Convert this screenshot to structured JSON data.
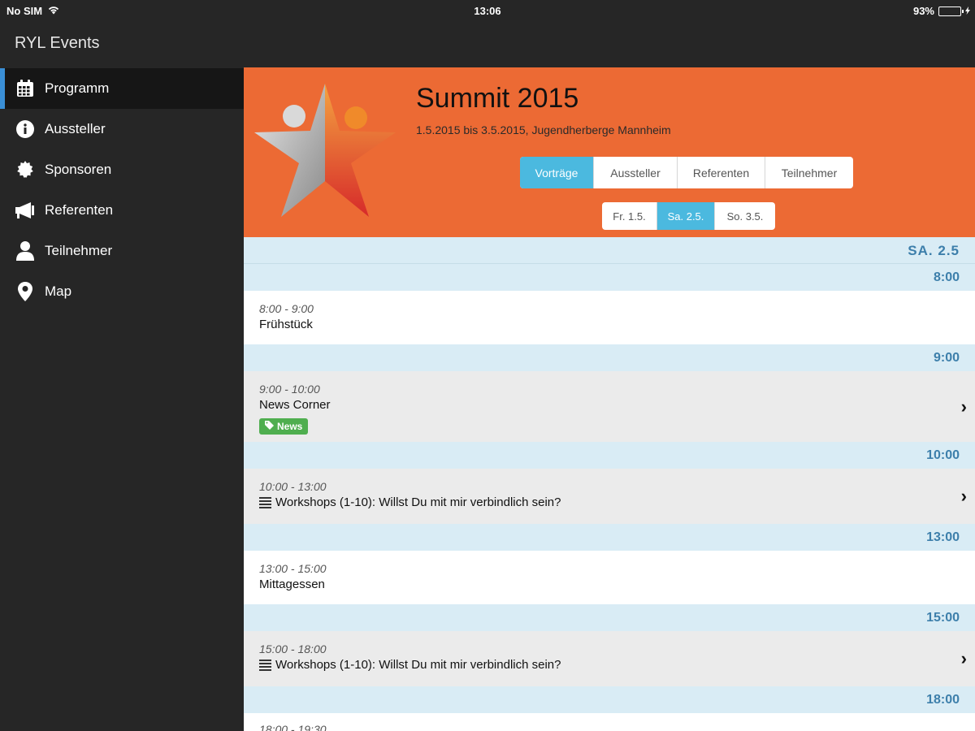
{
  "status_bar": {
    "carrier": "No SIM",
    "time": "13:06",
    "battery": "93%",
    "battery_level": 0.93
  },
  "sidebar": {
    "title": "RYL Events",
    "items": [
      {
        "label": "Programm",
        "icon": "calendar-icon",
        "active": true
      },
      {
        "label": "Aussteller",
        "icon": "info-icon",
        "active": false
      },
      {
        "label": "Sponsoren",
        "icon": "badge-icon",
        "active": false
      },
      {
        "label": "Referenten",
        "icon": "megaphone-icon",
        "active": false
      },
      {
        "label": "Teilnehmer",
        "icon": "person-icon",
        "active": false
      },
      {
        "label": "Map",
        "icon": "map-marker-icon",
        "active": false
      }
    ]
  },
  "event": {
    "title": "Summit 2015",
    "subtitle": "1.5.2015 bis 3.5.2015, Jugendherberge Mannheim",
    "tabs": [
      "Vorträge",
      "Aussteller",
      "Referenten",
      "Teilnehmer"
    ],
    "active_tab": "Vorträge",
    "days": [
      "Fr. 1.5.",
      "Sa. 2.5.",
      "So. 3.5."
    ],
    "active_day": "Sa. 2.5."
  },
  "schedule": {
    "day_label": "SA. 2.5",
    "slots": [
      {
        "header": "8:00",
        "time": "8:00 - 9:00",
        "title": "Frühstück",
        "linked": false,
        "tag": "",
        "list_icon": false
      },
      {
        "header": "9:00",
        "time": "9:00 - 10:00",
        "title": "News Corner",
        "linked": true,
        "tag": "News",
        "list_icon": false
      },
      {
        "header": "10:00",
        "time": "10:00 - 13:00",
        "title": "Workshops (1-10): Willst Du mit mir verbindlich sein?",
        "linked": true,
        "tag": "",
        "list_icon": true
      },
      {
        "header": "13:00",
        "time": "13:00 - 15:00",
        "title": "Mittagessen",
        "linked": false,
        "tag": "",
        "list_icon": false
      },
      {
        "header": "15:00",
        "time": "15:00 - 18:00",
        "title": "Workshops (1-10): Willst Du mit mir verbindlich sein?",
        "linked": true,
        "tag": "",
        "list_icon": true
      },
      {
        "header": "18:00",
        "time": "18:00 - 19:30",
        "title": "",
        "linked": false,
        "tag": "",
        "list_icon": false
      }
    ]
  },
  "colors": {
    "hero": "#ec6a34",
    "accent": "#4bb9df",
    "sidebar": "#262626",
    "time_header_bg": "#d9ecf5",
    "time_header_text": "#3d7fab",
    "tag": "#4fae4f"
  }
}
